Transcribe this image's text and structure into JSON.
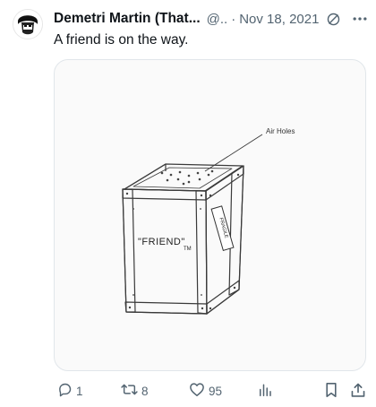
{
  "tweet": {
    "author_name": "Demetri Martin (That...",
    "handle": "@..",
    "separator": "·",
    "date": "Nov 18, 2021",
    "text": "A friend is on the way."
  },
  "image": {
    "drawing_label": "\"FRIEND\"",
    "trademark": "TM",
    "annotation": "Air Holes",
    "sticker": "FRAGILE"
  },
  "actions": {
    "reply_count": "1",
    "retweet_count": "8",
    "like_count": "95"
  },
  "icons": [
    "avatar",
    "edit-icon",
    "more-icon",
    "reply-icon",
    "retweet-icon",
    "like-icon",
    "views-icon",
    "bookmark-icon",
    "share-icon"
  ]
}
